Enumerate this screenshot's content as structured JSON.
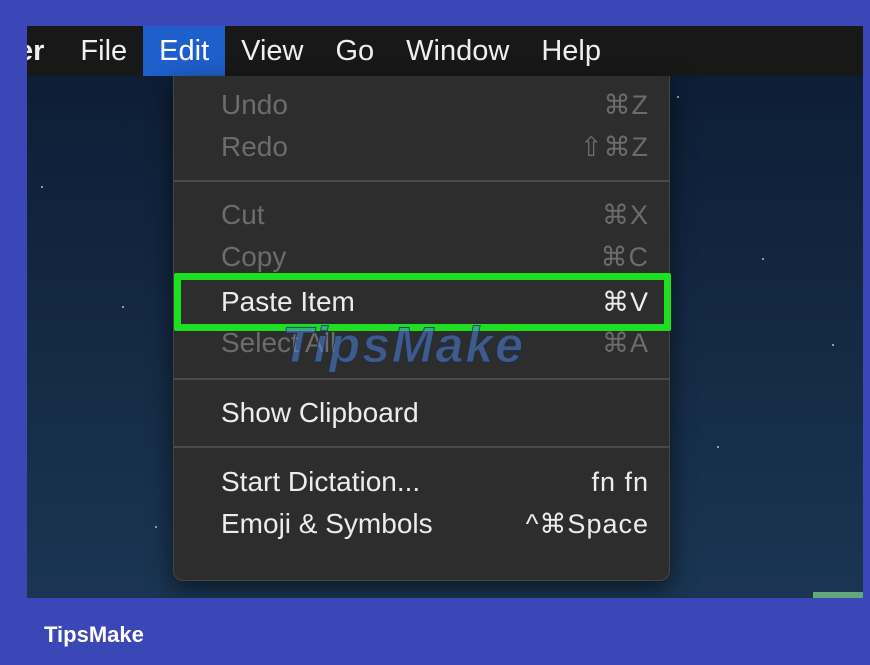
{
  "menubar": {
    "items": [
      "er",
      "File",
      "Edit",
      "View",
      "Go",
      "Window",
      "Help"
    ]
  },
  "edit_menu": {
    "undo": {
      "label": "Undo",
      "shortcut": "⌘Z"
    },
    "redo": {
      "label": "Redo",
      "shortcut": "⇧⌘Z"
    },
    "cut": {
      "label": "Cut",
      "shortcut": "⌘X"
    },
    "copy": {
      "label": "Copy",
      "shortcut": "⌘C"
    },
    "paste_item": {
      "label": "Paste Item",
      "shortcut": "⌘V"
    },
    "select_all": {
      "label": "Select All",
      "shortcut": "⌘A"
    },
    "show_clipboard": {
      "label": "Show Clipboard"
    },
    "start_dictation": {
      "label": "Start Dictation...",
      "shortcut": "fn fn"
    },
    "emoji_symbols": {
      "label": "Emoji & Symbols",
      "shortcut": "^⌘Space"
    }
  },
  "watermark": "TipsMake",
  "footer": {
    "brand": "TipsMake"
  },
  "colors": {
    "frame": "#3b46b7",
    "menu_bg": "#2d2d2d",
    "active_menu": "#1f5fcb",
    "highlight": "#1ee021"
  }
}
